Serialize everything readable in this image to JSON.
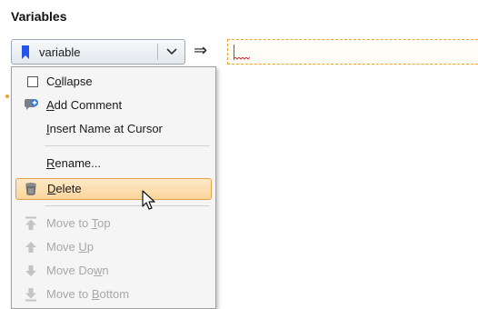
{
  "section": {
    "title": "Variables"
  },
  "variable_dropdown": {
    "value": "variable"
  },
  "assignment": {
    "arrow": "⇒",
    "field_value": ""
  },
  "context_menu": {
    "items": [
      {
        "pre": "C",
        "u": "o",
        "post": "llapse"
      },
      {
        "pre": "",
        "u": "A",
        "post": "dd Comment"
      },
      {
        "pre": "",
        "u": "I",
        "post": "nsert Name at Cursor"
      },
      {
        "pre": "",
        "u": "R",
        "post": "ename..."
      },
      {
        "pre": "",
        "u": "D",
        "post": "elete"
      },
      {
        "pre": "Move to ",
        "u": "T",
        "post": "op"
      },
      {
        "pre": "Move ",
        "u": "U",
        "post": "p"
      },
      {
        "pre": "Move Do",
        "u": "w",
        "post": "n"
      },
      {
        "pre": "Move to ",
        "u": "B",
        "post": "ottom"
      }
    ]
  },
  "colors": {
    "accent_flag": "#2255ee",
    "highlight_border": "#e2a24a",
    "dashed_border": "#f0a030",
    "disabled_text": "#a8a8a8"
  },
  "icons": {
    "collapse": "checkbox-icon",
    "add_comment": "comment-add-icon",
    "delete": "trash-can-icon",
    "move_top": "move-to-top-icon",
    "move_up": "arrow-up-icon",
    "move_down": "arrow-down-icon",
    "move_bottom": "move-to-bottom-icon"
  }
}
